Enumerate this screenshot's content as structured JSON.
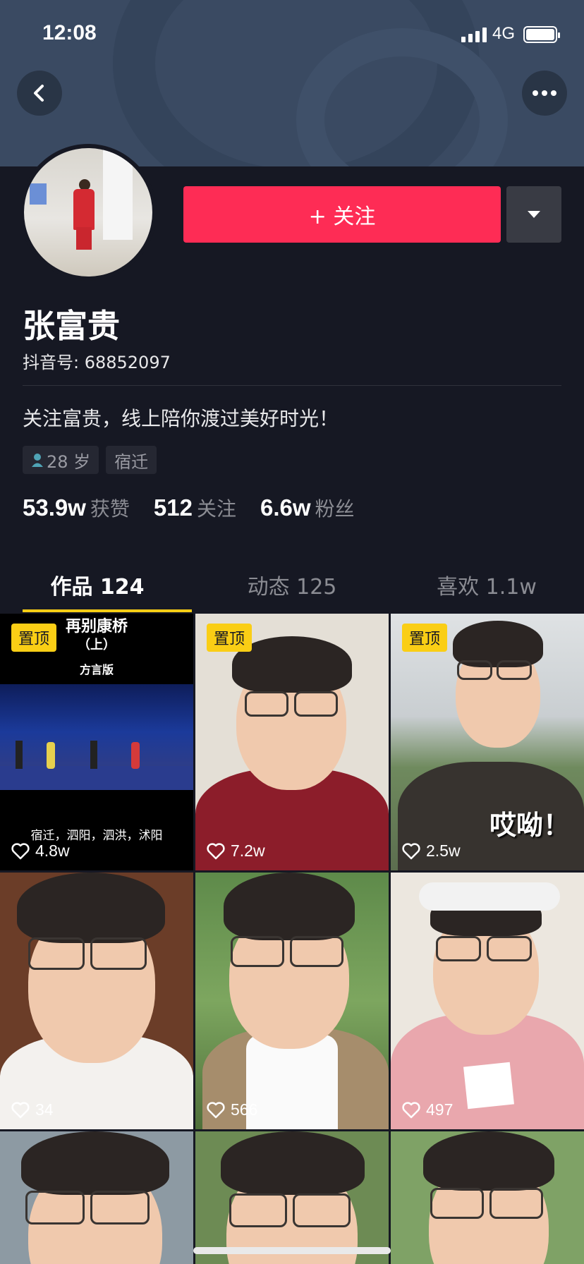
{
  "status_bar": {
    "time": "12:08",
    "network": "4G"
  },
  "header": {
    "back_icon": "chevron-left-icon",
    "more_icon": "more-dots-icon"
  },
  "profile": {
    "follow_label": "+ 关注",
    "name": "张富贵",
    "douyin_id": "抖音号: 68852097",
    "bio": "关注富贵，线上陪你渡过美好时光！",
    "tags": [
      "28 岁",
      "宿迁"
    ],
    "stats": [
      {
        "num": "53.9w",
        "label": "获赞"
      },
      {
        "num": "512",
        "label": "关注"
      },
      {
        "num": "6.6w",
        "label": "粉丝"
      }
    ]
  },
  "tabs": [
    "作品 124",
    "动态 125",
    "喜欢 1.1w"
  ],
  "videos": [
    {
      "pinned": "置顶",
      "likes": "4.8w",
      "title_top": "再别康桥",
      "title_sub": "（上）",
      "title_note": "方言版",
      "caption": "宿迁，泗阳，泗洪，沭阳"
    },
    {
      "pinned": "置顶",
      "likes": "7.2w"
    },
    {
      "pinned": "置顶",
      "likes": "2.5w",
      "overlay": "哎呦！"
    },
    {
      "likes": "34"
    },
    {
      "likes": "566"
    },
    {
      "likes": "497"
    },
    {
      "likes": ""
    },
    {
      "likes": ""
    },
    {
      "likes": ""
    }
  ],
  "colors": {
    "accent": "#fe2c55",
    "pin": "#face15",
    "bg": "#161823"
  }
}
